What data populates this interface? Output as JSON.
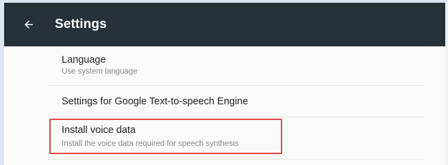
{
  "appbar": {
    "title": "Settings",
    "back_icon": "arrow-left-icon",
    "background": "#263238"
  },
  "items": [
    {
      "label": "Language",
      "sub": "Use system language"
    },
    {
      "label": "Settings for Google Text-to-speech Engine",
      "sub": ""
    },
    {
      "label": "Install voice data",
      "sub": "Install the voice data required for speech synthesis"
    }
  ],
  "highlight_color": "#e0453b"
}
